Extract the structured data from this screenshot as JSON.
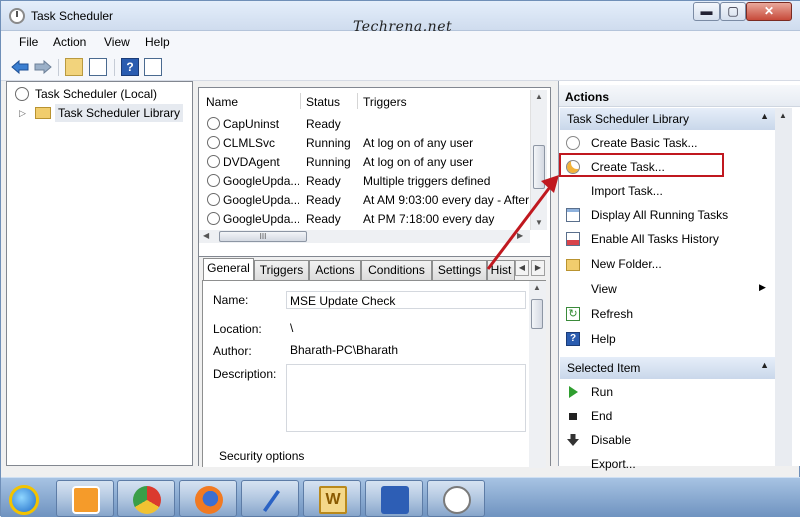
{
  "window": {
    "title": "Task Scheduler",
    "watermark": "Techrena.net",
    "min_label": "▬",
    "max_label": "▢",
    "close_label": "✕"
  },
  "menu": [
    "File",
    "Action",
    "View",
    "Help"
  ],
  "toolbar": {
    "help_label": "?"
  },
  "tree": {
    "root": "Task Scheduler (Local)",
    "child": "Task Scheduler Library",
    "expander": "▷"
  },
  "tasklist": {
    "columns": [
      "Name",
      "Status",
      "Triggers"
    ],
    "rows": [
      {
        "name": "CapUninst",
        "status": "Ready",
        "trigger": ""
      },
      {
        "name": "CLMLSvc",
        "status": "Running",
        "trigger": "At log on of any user"
      },
      {
        "name": "DVDAgent",
        "status": "Running",
        "trigger": "At log on of any user"
      },
      {
        "name": "GoogleUpda...",
        "status": "Ready",
        "trigger": "Multiple triggers defined"
      },
      {
        "name": "GoogleUpda...",
        "status": "Ready",
        "trigger": "At AM 9:03:00 every day - After"
      },
      {
        "name": "GoogleUpda...",
        "status": "Ready",
        "trigger": "At PM 7:18:00 every day"
      }
    ],
    "hscroll_grip": "III"
  },
  "details": {
    "tabs": [
      "General",
      "Triggers",
      "Actions",
      "Conditions",
      "Settings",
      "Hist"
    ],
    "name_label": "Name:",
    "name_value": "MSE Update Check",
    "location_label": "Location:",
    "location_value": "\\",
    "author_label": "Author:",
    "author_value": "Bharath-PC\\Bharath",
    "description_label": "Description:",
    "security_label": "Security options"
  },
  "actions": {
    "header": "Actions",
    "section1": "Task Scheduler Library",
    "items1": [
      {
        "label": "Create Basic Task...",
        "icon": "create-basic-task-icon"
      },
      {
        "label": "Create Task...",
        "icon": "create-task-icon"
      },
      {
        "label": "Import Task...",
        "icon": "import-icon"
      },
      {
        "label": "Display All Running Tasks",
        "icon": "running-tasks-icon"
      },
      {
        "label": "Enable All Tasks History",
        "icon": "history-icon"
      },
      {
        "label": "New Folder...",
        "icon": "new-folder-icon"
      },
      {
        "label": "View",
        "icon": "view-icon"
      },
      {
        "label": "Refresh",
        "icon": "refresh-icon"
      },
      {
        "label": "Help",
        "icon": "help-icon"
      }
    ],
    "section2": "Selected Item",
    "items2": [
      {
        "label": "Run",
        "icon": "run-icon"
      },
      {
        "label": "End",
        "icon": "end-icon"
      },
      {
        "label": "Disable",
        "icon": "disable-icon"
      },
      {
        "label": "Export...",
        "icon": "export-icon"
      }
    ],
    "collapse": "▲",
    "submenu_arrow": "▶"
  },
  "taskbar": {
    "apps": [
      "internet-explorer",
      "media-player",
      "chrome",
      "firefox",
      "pen-app",
      "word",
      "network-app",
      "clock-app"
    ]
  },
  "colors": {
    "highlight": "#c0181f",
    "section_bg": "#c9d7ea",
    "taskbar": "#6f93c0"
  }
}
